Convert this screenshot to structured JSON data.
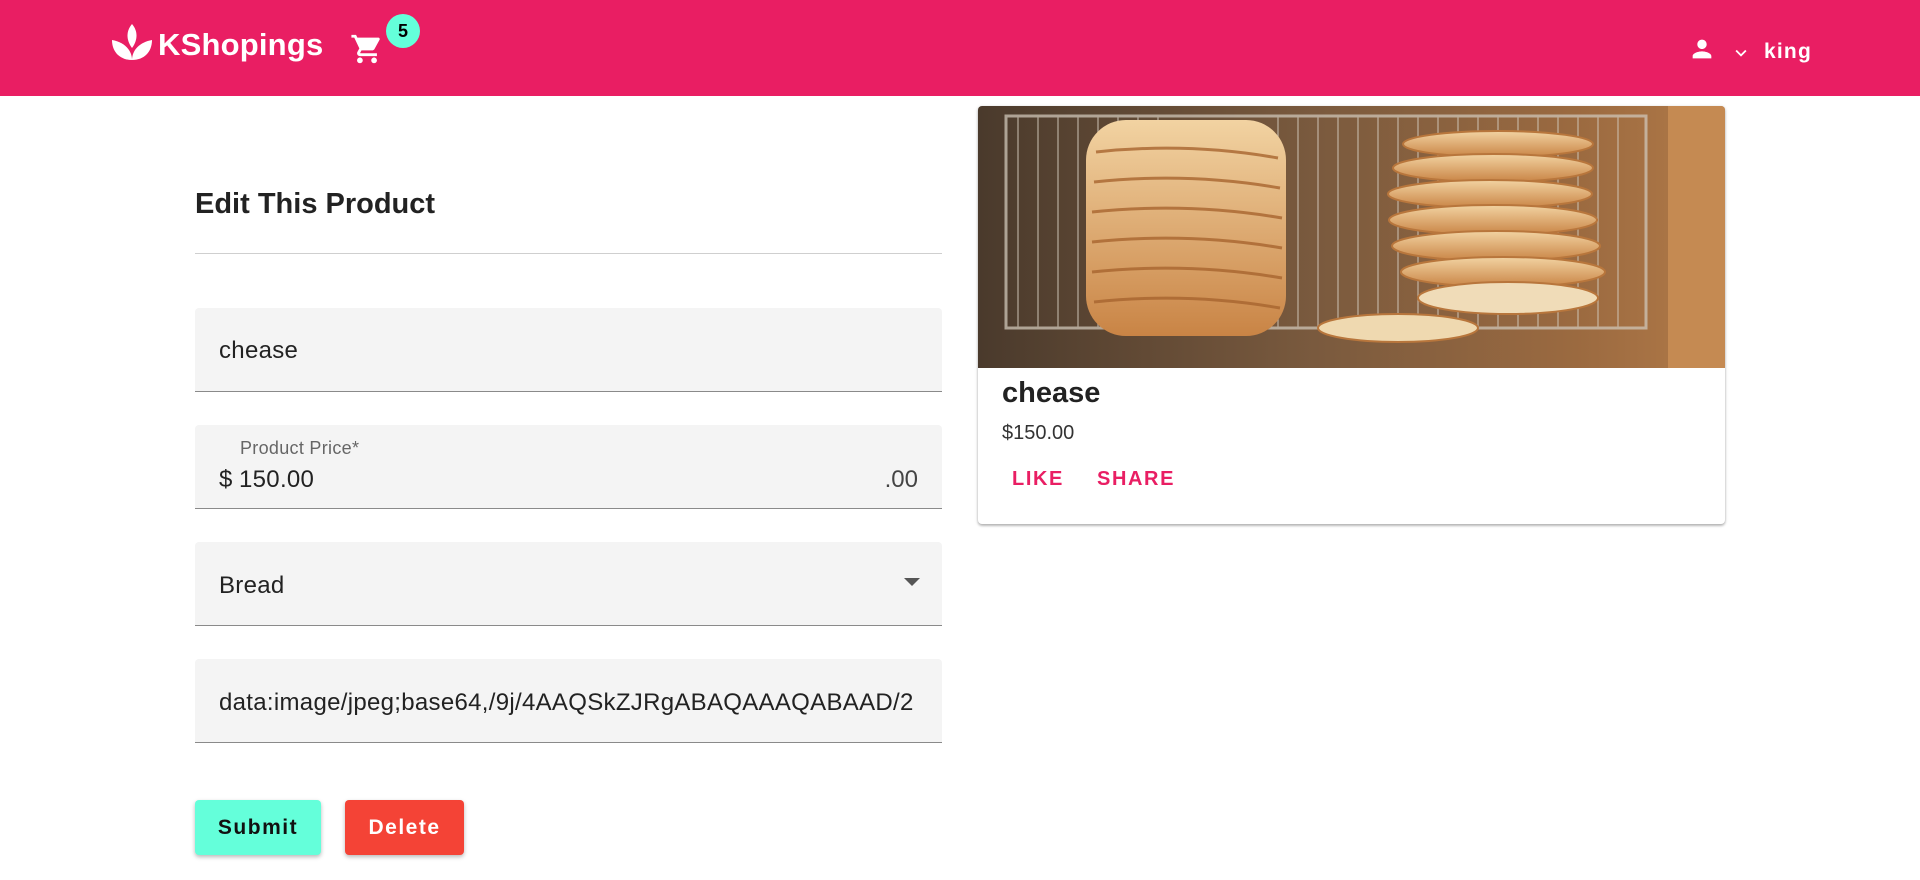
{
  "app": {
    "brand_name": "KShopings",
    "brand_color": "#e91e63",
    "accent_color": "#64ffda",
    "danger_color": "#f44336",
    "cart_count": "5",
    "user_name": "king"
  },
  "form": {
    "title": "Edit This Product",
    "name_value": "chease",
    "price_label": "Product Price*",
    "price_prefix": "$",
    "price_value": "150.00",
    "price_suffix": ".00",
    "category_value": "Bread",
    "image_value": "data:image/jpeg;base64,/9j/4AAQSkZJRgABAQAAAQABAAD/2",
    "submit_label": "Submit",
    "delete_label": "Delete"
  },
  "card": {
    "title": "chease",
    "price": "$150.00",
    "like_label": "LIKE",
    "share_label": "SHARE",
    "image_icon": "bread-slices-on-rack-photo"
  },
  "icons": {
    "logo": "lotus-logo-icon",
    "cart": "shopping-cart-icon",
    "user": "person-icon",
    "dropdown": "chevron-down-icon",
    "select": "caret-down-icon"
  }
}
